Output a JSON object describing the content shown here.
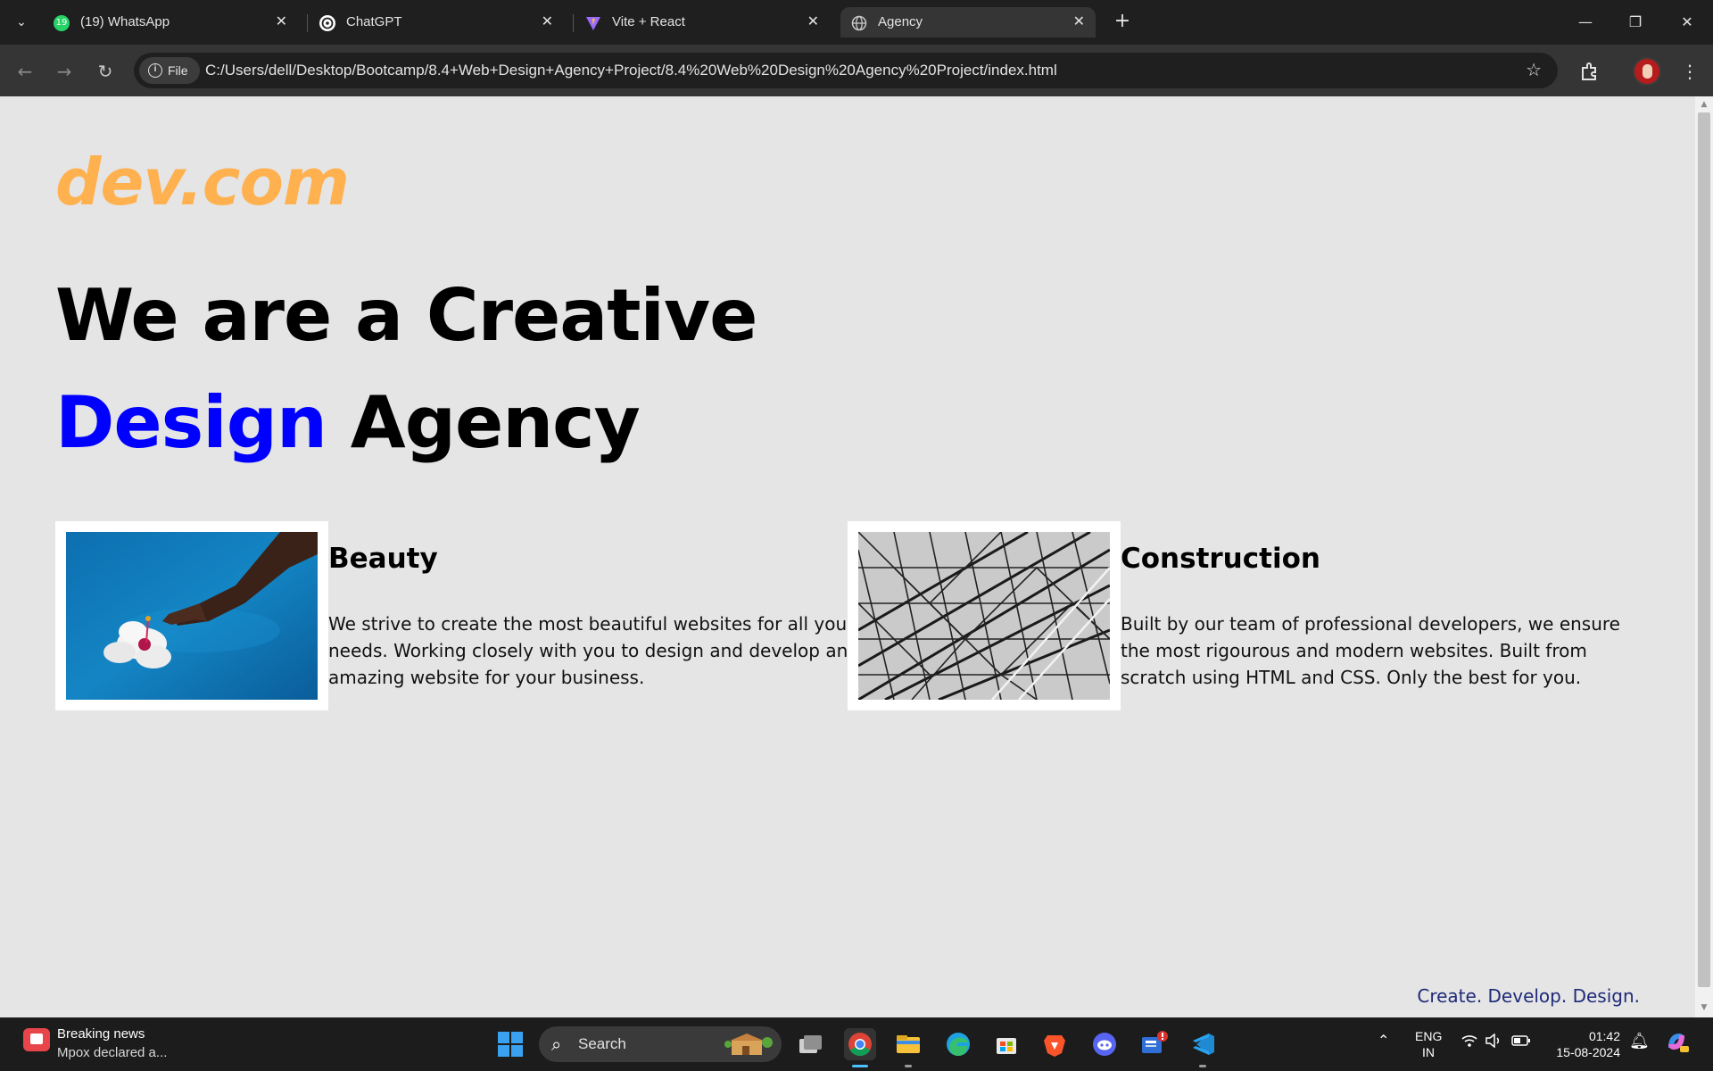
{
  "browser": {
    "tabs": [
      {
        "title": "(19) WhatsApp",
        "badge": "19",
        "active": false
      },
      {
        "title": "ChatGPT",
        "active": false
      },
      {
        "title": "Vite + React",
        "active": false
      },
      {
        "title": "Agency",
        "active": true
      }
    ],
    "url_chip": "File",
    "url": "C:/Users/dell/Desktop/Bootcamp/8.4+Web+Design+Agency+Project/8.4%20Web%20Design%20Agency%20Project/index.html"
  },
  "page": {
    "logo": "dev.com",
    "hero": {
      "line1": "We are a Creative",
      "accent_word": "Design",
      "line2_rest": " Agency"
    },
    "services": [
      {
        "title": "Beauty",
        "text": "We strive to create the most beautiful websites for all your needs. Working closely with you to design and develop an amazing website for your business."
      },
      {
        "title": "Construction",
        "text": "Built by our team of professional developers, we ensure the most rigourous and modern websites. Built from scratch using HTML and CSS. Only the best for you."
      }
    ],
    "tagline": "Create. Develop. Design.",
    "colors": {
      "logo": "#ffb150",
      "accent": "#0000ff",
      "background": "#e5e5e5",
      "tagline": "#1f2a78"
    }
  },
  "taskbar": {
    "news_title": "Breaking news",
    "news_sub": "Mpox declared a...",
    "search_label": "Search",
    "language_top": "ENG",
    "language_bottom": "IN",
    "time": "01:42",
    "date": "15-08-2024",
    "apps": [
      "task-view",
      "chrome",
      "file-explorer",
      "edge",
      "microsoft-store",
      "brave",
      "discord",
      "news-widget",
      "vscode"
    ]
  }
}
